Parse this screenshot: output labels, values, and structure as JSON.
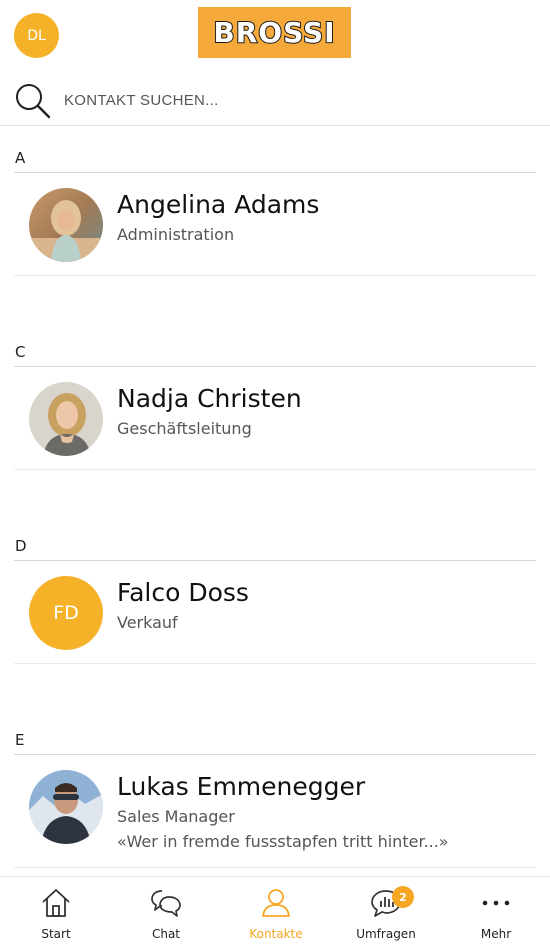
{
  "header": {
    "user_initials": "DL",
    "logo_text": "BROSSI"
  },
  "search": {
    "placeholder": "KONTAKT SUCHEN...",
    "value": ""
  },
  "sections": [
    {
      "letter": "A",
      "contacts": [
        {
          "name": "Angelina Adams",
          "role": "Administration"
        }
      ]
    },
    {
      "letter": "C",
      "contacts": [
        {
          "name": "Nadja Christen",
          "role": "Geschäftsleitung"
        }
      ]
    },
    {
      "letter": "D",
      "contacts": [
        {
          "name": "Falco Doss",
          "role": "Verkauf",
          "initials": "FD"
        }
      ]
    },
    {
      "letter": "E",
      "contacts": [
        {
          "name": "Lukas Emmenegger",
          "role": "Sales Manager",
          "quote": "«Wer in fremde fussstapfen tritt hinter...»"
        }
      ]
    }
  ],
  "tabs": [
    {
      "label": "Start",
      "icon": "home-icon"
    },
    {
      "label": "Chat",
      "icon": "chat-icon"
    },
    {
      "label": "Kontakte",
      "icon": "person-icon",
      "active": true
    },
    {
      "label": "Umfragen",
      "icon": "poll-icon",
      "badge": "2"
    },
    {
      "label": "Mehr",
      "icon": "more-icon"
    }
  ],
  "colors": {
    "accent": "#f5a623",
    "avatar": "#f5b229",
    "logo_bg": "#f5a93b"
  }
}
